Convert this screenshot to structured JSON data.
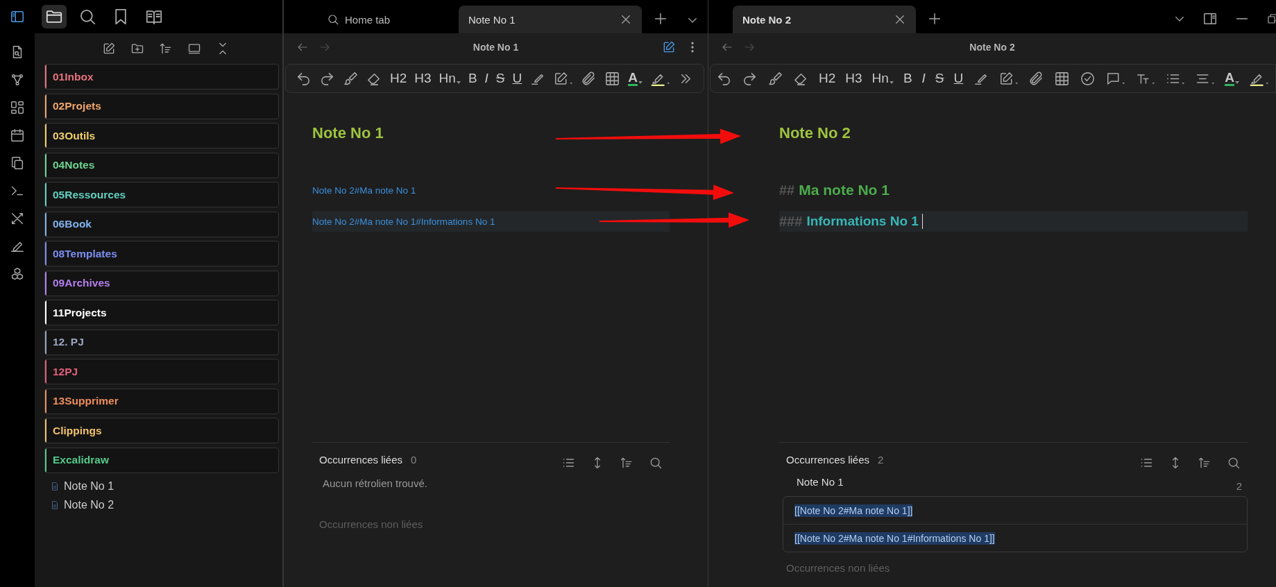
{
  "top_tabs": [
    {
      "kind": "files",
      "selected": true
    },
    {
      "kind": "search",
      "selected": false
    },
    {
      "kind": "bookmark",
      "selected": false
    },
    {
      "kind": "book",
      "selected": false
    }
  ],
  "folders": [
    {
      "name": "01Inbox",
      "color": "#e8737f"
    },
    {
      "name": "02Projets",
      "color": "#f0a56c"
    },
    {
      "name": "03Outils",
      "color": "#f2d16b"
    },
    {
      "name": "04Notes",
      "color": "#6fd492"
    },
    {
      "name": "05Ressources",
      "color": "#62d1bf"
    },
    {
      "name": "06Book",
      "color": "#7fb2ef"
    },
    {
      "name": "08Templates",
      "color": "#7c8ff0"
    },
    {
      "name": "09Archives",
      "color": "#b67ff0"
    },
    {
      "name": "11Projects",
      "color": "#ffffff"
    },
    {
      "name": "12. PJ",
      "color": "#9aa5bf"
    },
    {
      "name": "12PJ",
      "color": "#e2607b"
    },
    {
      "name": "13Supprimer",
      "color": "#f08e5c"
    },
    {
      "name": "Clippings",
      "color": "#f3c36a"
    },
    {
      "name": "Excalidraw",
      "color": "#55c98a"
    }
  ],
  "notes": [
    "Note No 1",
    "Note No 2"
  ],
  "panes": [
    {
      "tabs": [
        {
          "kind": "search",
          "label": "Home tab",
          "selected": false
        },
        {
          "kind": "note",
          "label": "Note No 1",
          "selected": true
        }
      ],
      "window_controls": false,
      "title": "Note No 1",
      "actions": true,
      "toolbar": [
        {
          "kind": "undo"
        },
        {
          "kind": "redo"
        },
        {
          "kind": "brush"
        },
        {
          "kind": "eraser"
        },
        {
          "kind": "h2",
          "label": "H2"
        },
        {
          "kind": "h3",
          "label": "H3"
        },
        {
          "kind": "hn",
          "label": "Hn"
        },
        {
          "kind": "bold",
          "label": "B"
        },
        {
          "kind": "italic",
          "label": "I"
        },
        {
          "kind": "strike",
          "label": "S"
        },
        {
          "kind": "underline",
          "label": "U"
        },
        {
          "kind": "marker"
        },
        {
          "kind": "edit"
        },
        {
          "kind": "paperclip"
        },
        {
          "kind": "table"
        },
        {
          "kind": "font-color",
          "label": "A"
        },
        {
          "kind": "highlight"
        },
        {
          "kind": "more"
        }
      ],
      "heading": "Note No 1",
      "lines": [
        {
          "kind": "link",
          "text": "Note No 2#Ma note No 1",
          "active": false,
          "cursor": false
        },
        {
          "kind": "link",
          "text": "Note No 2#Ma note No 1#Informations No 1",
          "active": true,
          "cursor": false
        }
      ],
      "backlinks": {
        "title": "Occurrences liées",
        "count": "0",
        "empty": "Aucun rétrolien trouvé.",
        "unlinked": "Occurrences non liées"
      }
    },
    {
      "tabs": [
        {
          "kind": "note",
          "label": "Note No 2",
          "selected": true
        }
      ],
      "window_controls": true,
      "title": "Note No 2",
      "actions": false,
      "toolbar": [
        {
          "kind": "undo"
        },
        {
          "kind": "redo"
        },
        {
          "kind": "brush"
        },
        {
          "kind": "eraser"
        },
        {
          "kind": "h2",
          "label": "H2"
        },
        {
          "kind": "h3",
          "label": "H3"
        },
        {
          "kind": "hn",
          "label": "Hn"
        },
        {
          "kind": "bold",
          "label": "B"
        },
        {
          "kind": "italic",
          "label": "I"
        },
        {
          "kind": "strike",
          "label": "S"
        },
        {
          "kind": "underline",
          "label": "U"
        },
        {
          "kind": "marker"
        },
        {
          "kind": "edit"
        },
        {
          "kind": "paperclip"
        },
        {
          "kind": "table"
        },
        {
          "kind": "check"
        },
        {
          "kind": "comment"
        },
        {
          "kind": "text-format"
        },
        {
          "kind": "list"
        },
        {
          "kind": "align"
        },
        {
          "kind": "font-color",
          "label": "A"
        },
        {
          "kind": "highlight"
        }
      ],
      "heading": "Note No 2",
      "lines": [
        {
          "kind": "h2",
          "marker": "##",
          "text": "Ma note No 1",
          "active": false,
          "cursor": false
        },
        {
          "kind": "h3",
          "marker": "###",
          "text": "Informations No 1",
          "active": true,
          "cursor": true
        }
      ],
      "backlinks": {
        "title": "Occurrences liées",
        "count": "2",
        "results": [
          {
            "file": "Note No 1",
            "count": "2",
            "matches": [
              "[[Note No 2#Ma note No 1]]",
              "[[Note No 2#Ma note No 1#Informations No 1]]"
            ]
          }
        ],
        "unlinked": "Occurrences non liées"
      }
    }
  ]
}
